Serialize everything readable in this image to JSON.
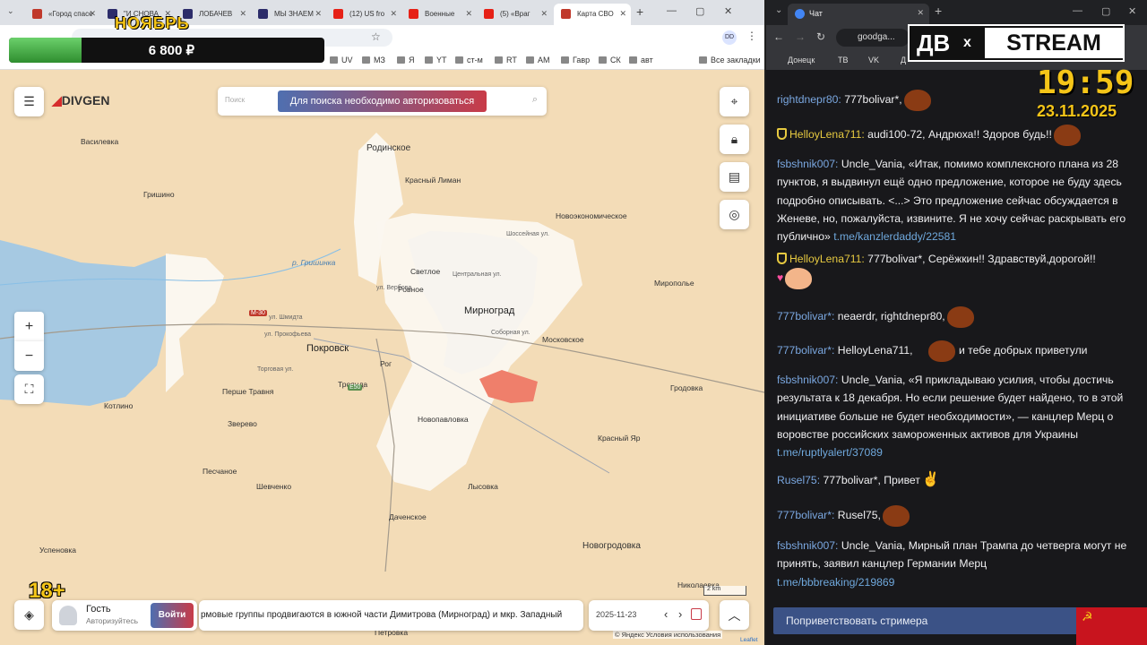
{
  "left_browser": {
    "tabs": [
      {
        "title": "«Город спасе"
      },
      {
        "title": "\"И СНОВА"
      },
      {
        "title": "ЛОБАЧЕВ"
      },
      {
        "title": "МЫ ЗНАЕМ"
      },
      {
        "title": "(12) US fro"
      },
      {
        "title": "Военные"
      },
      {
        "title": "(5) «Враг"
      },
      {
        "title": "Карта СВО"
      }
    ],
    "new_tab": "+",
    "window_controls": [
      "—",
      "▢",
      "✕"
    ],
    "bookmarks": [
      "UV",
      "МЗ",
      "Я",
      "YT",
      "ст-м",
      "RT",
      "АМ",
      "Гавр",
      "СК",
      "авт"
    ],
    "all_bookmarks": "Все закладки",
    "profile": "DD"
  },
  "promo": {
    "month": "НОЯБРЬ",
    "amount": "6 800 ₽",
    "progress": 0.23
  },
  "map": {
    "brand": "DIVGEN",
    "search_placeholder": "Поиск",
    "search_notice": "Для поиска необходимо авторизоваться",
    "zoom_in": "+",
    "zoom_out": "−",
    "scale": "2 km",
    "attribution": "© Яндекс Условия использования",
    "leaflet": "Leaflet",
    "towns": [
      {
        "name": "Родинское"
      },
      {
        "name": "Василевка"
      },
      {
        "name": "Красный Лиман"
      },
      {
        "name": "Новоэкономическое"
      },
      {
        "name": "Гришино"
      },
      {
        "name": "р. Гришинка"
      },
      {
        "name": "Светлое"
      },
      {
        "name": "Ровное"
      },
      {
        "name": "Мирноград"
      },
      {
        "name": "Мирополье"
      },
      {
        "name": "Покровск"
      },
      {
        "name": "Московское"
      },
      {
        "name": "Перше Травня"
      },
      {
        "name": "Троянда"
      },
      {
        "name": "Рог"
      },
      {
        "name": "Котлино"
      },
      {
        "name": "Зверево"
      },
      {
        "name": "Новопавловка"
      },
      {
        "name": "Гродовка"
      },
      {
        "name": "Красный Яр"
      },
      {
        "name": "Песчаное"
      },
      {
        "name": "Шевченко"
      },
      {
        "name": "Лысовка"
      },
      {
        "name": "Даченское"
      },
      {
        "name": "Новогродовка"
      },
      {
        "name": "Успеновка"
      },
      {
        "name": "Николаевка"
      },
      {
        "name": "Торговая ул."
      },
      {
        "name": "ул. Шмидта"
      },
      {
        "name": "ул. Прокофьева"
      },
      {
        "name": "Центральная ул."
      },
      {
        "name": "Соборная ул."
      },
      {
        "name": "ул. Вербова"
      },
      {
        "name": "Шоссейная ул."
      },
      {
        "name": "М-30"
      },
      {
        "name": "E50"
      },
      {
        "name": "Петровка"
      }
    ]
  },
  "bottom_bar": {
    "user": "Гость",
    "user_status": "Авторизуйтесь",
    "login": "Войти",
    "news": "рмовые группы продвигаются в южной части Димитрова (Мирноград) и мкр. Западный",
    "date": "2025-11-23",
    "age": "18+"
  },
  "right_browser": {
    "tab_title": "Чат",
    "url": "goodga...",
    "bookmarks": [
      "Донецк",
      "ТВ",
      "VK",
      "Д"
    ]
  },
  "stream": {
    "logo_left": "ДВ",
    "logo_x": "x",
    "logo_right": "STREAM",
    "time": "19:59",
    "date": "23.11.2025"
  },
  "chat": {
    "messages": [
      {
        "user": "rightdnepr80:",
        "text": " 777bolivar*,",
        "color": "blue"
      },
      {
        "user": "HelloyLena711:",
        "text": " audi100-72, Андрюха!! Здоров будь!!",
        "color": "yellow"
      },
      {
        "user": "fsbshnik007:",
        "text": " Uncle_Vania, «Итак, помимо комплексного плана из 28 пунктов, я выдвинул ещё одно предложение, которое не буду здесь подробно описывать. <...> Это предложение сейчас обсуждается в Женеве, но, пожалуйста, извините. Я не хочу сейчас раскрывать его публично»",
        "link": "t.me/kanzlerdaddy/22581",
        "color": "blue"
      },
      {
        "user": "HelloyLena711:",
        "text": " 777bolivar*, Серёжкин!! Здравствуй,дорогой!!",
        "color": "yellow"
      },
      {
        "user": "777bolivar*:",
        "text": " neaerdr, rightdnepr80,",
        "color": "blue"
      },
      {
        "user": "777bolivar*:",
        "text": " HelloyLena711,",
        "text2": "и тебе добрых приветули",
        "color": "blue"
      },
      {
        "user": "fsbshnik007:",
        "text": " Uncle_Vania, «Я прикладываю усилия, чтобы достичь результата к 18 декабря. Но если решение будет найдено, то в этой инициативе больше не будет необходимости», — канцлер Мерц о воровстве российских замороженных активов для Украины",
        "link": "t.me/ruptlyalert/37089",
        "color": "blue"
      },
      {
        "user": "Rusel75:",
        "text": " 777bolivar*, Привет",
        "color": "blue"
      },
      {
        "user": "777bolivar*:",
        "text": " Rusel75,",
        "color": "blue"
      },
      {
        "user": "fsbshnik007:",
        "text": " Uncle_Vania, Мирный план Трампа до четверга могут не принять, заявил канцлер Германии Мерц",
        "link": "t.me/bbbreaking/219869",
        "color": "blue"
      }
    ],
    "greet_button": "Поприветствовать стримера"
  }
}
